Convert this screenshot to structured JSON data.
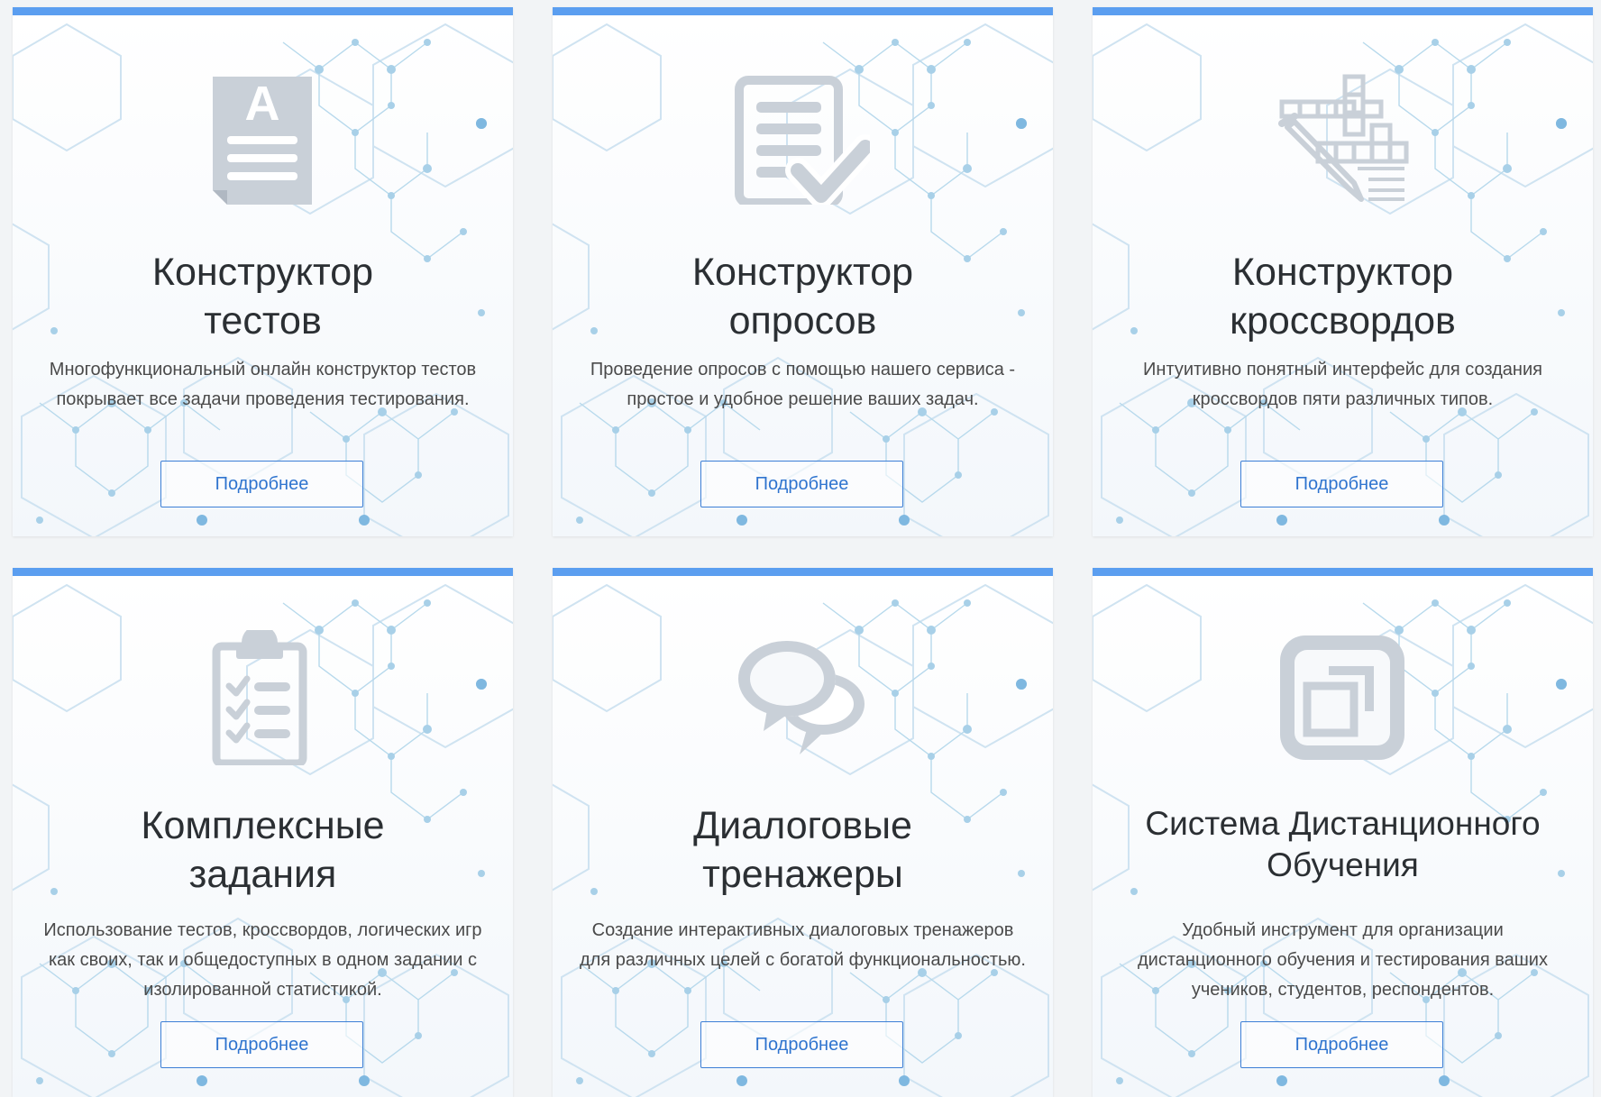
{
  "cards": [
    {
      "title_lines": [
        "Конструктор",
        "тестов"
      ],
      "description": "Многофункциональный онлайн конструктор тестов покрывает все задачи проведения тестирования.",
      "button": "Подробнее",
      "icon": "document-text-icon"
    },
    {
      "title_lines": [
        "Конструктор",
        "опросов"
      ],
      "description": "Проведение опросов с помощью нашего сервиса - простое и удобное решение ваших задач.",
      "button": "Подробнее",
      "icon": "document-check-icon"
    },
    {
      "title_lines": [
        "Конструктор",
        "кроссвордов"
      ],
      "description": "Интуитивно понятный интерфейс для создания кроссвордов пяти различных типов.",
      "button": "Подробнее",
      "icon": "crossword-pencil-icon"
    },
    {
      "title_lines": [
        "Комплексные",
        "задания"
      ],
      "description": "Использование тестов, кроссвордов, логических игр как своих, так и общедоступных в одном задании с изолированной статистикой.",
      "button": "Подробнее",
      "icon": "clipboard-checklist-icon"
    },
    {
      "title_lines": [
        "Диалоговые",
        "тренажеры"
      ],
      "description": "Создание интерактивных диалоговых тренажеров для различных целей с богатой функциональностью.",
      "button": "Подробнее",
      "icon": "speech-bubbles-icon"
    },
    {
      "title_lines": [
        "Система Дистанционного",
        "Обучения"
      ],
      "description": "Удобный инструмент для организации дистанционного обучения и тестирования ваших учеников, студентов, респондентов.",
      "button": "Подробнее",
      "icon": "window-restore-icon"
    }
  ],
  "colors": {
    "accent": "#5b9ef0",
    "icon": "#c9d0d8",
    "button_text": "#2f74cf",
    "title": "#2b2f33"
  }
}
